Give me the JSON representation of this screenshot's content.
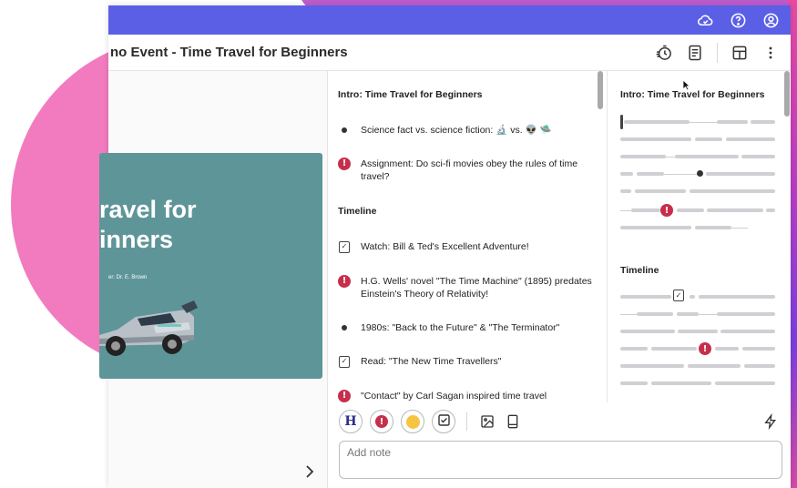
{
  "window": {
    "title": "no Event - Time Travel for Beginners"
  },
  "topbar": {
    "icons": [
      "cloud-check-icon",
      "help-icon",
      "account-icon"
    ]
  },
  "toolbar": {
    "icons": [
      "timer-icon",
      "notes-view-icon",
      "layout-icon",
      "more-menu-icon"
    ]
  },
  "slide": {
    "title_line1": "ravel for",
    "title_line2": "inners",
    "author": "er: Dr. E. Brown",
    "background_color": "#5e9599"
  },
  "notes": {
    "heading_intro": "Intro: Time Travel for Beginners",
    "heading_timeline": "Timeline",
    "items": [
      {
        "type": "bullet",
        "text": "Science fact vs. science fiction: 🔬 vs. 👽 🛸"
      },
      {
        "type": "exclaim",
        "text": "Assignment: Do sci-fi movies obey the rules of time travel?"
      },
      {
        "type": "task",
        "text": "Watch: Bill & Ted's Excellent Adventure!"
      },
      {
        "type": "exclaim",
        "text": "H.G. Wells' novel \"The Time Machine\" (1895) predates Einstein's Theory of Relativity!"
      },
      {
        "type": "bullet",
        "text": "1980s: \"Back to the Future\" & \"The Terminator\""
      },
      {
        "type": "task",
        "text": "Read: \"The New Time Travellers\""
      },
      {
        "type": "exclaim",
        "text": "\"Contact\" by Carl Sagan inspired time travel"
      }
    ]
  },
  "outline": {
    "heading_intro": "Intro: Time Travel for Beginners",
    "heading_timeline": "Timeline"
  },
  "editor": {
    "heading_button": "H",
    "placeholder": "Add note",
    "tools": [
      "heading",
      "important",
      "thinking",
      "task",
      "image",
      "tablet"
    ]
  },
  "colors": {
    "topbar": "#5b5fe6",
    "important": "#c62f4b",
    "slide_bg": "#5e9599",
    "accent_pink": "#f27bbf"
  }
}
